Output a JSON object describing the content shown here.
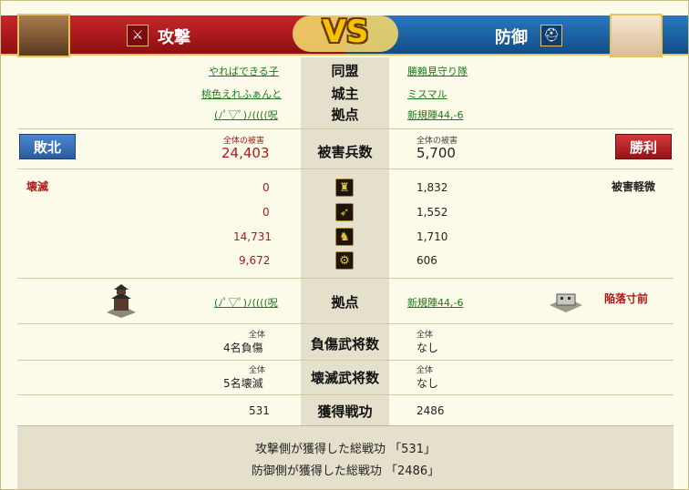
{
  "header": {
    "attack_label": "攻撃",
    "defense_label": "防御",
    "vs_label": "VS",
    "colors": {
      "attack": "#c8262a",
      "defense": "#2a78c0",
      "gold": "#e6c25a"
    }
  },
  "alliance": {
    "label": "同盟",
    "attacker": "やればできる子",
    "defender": "勝賴見守り隊"
  },
  "lord": {
    "label": "城主",
    "attacker": "桃色えれふぁんと",
    "defender": "ミスマル"
  },
  "base": {
    "label": "拠点",
    "attacker": "(ﾉﾟ▽ﾟ)ﾉ((((呪",
    "defender": "新規陣44,-6"
  },
  "damage": {
    "label": "被害兵数",
    "result_attacker": "敗北",
    "result_defender": "勝利",
    "attacker_caption": "全体の被害",
    "attacker_total": "24,403",
    "defender_caption": "全体の被害",
    "defender_total": "5,700"
  },
  "units": {
    "attacker_status": "壊滅",
    "defender_status": "被害軽微",
    "rows": [
      {
        "icon": "spear-icon",
        "attacker": "0",
        "defender": "1,832"
      },
      {
        "icon": "bow-icon",
        "attacker": "0",
        "defender": "1,552"
      },
      {
        "icon": "horse-icon",
        "attacker": "14,731",
        "defender": "1,710"
      },
      {
        "icon": "siege-icon",
        "attacker": "9,672",
        "defender": "606"
      }
    ]
  },
  "base_section": {
    "label": "拠点",
    "attacker": "(ﾉﾟ▽ﾟ)ﾉ((((呪",
    "defender": "新規陣44,-6",
    "defender_status": "陥落寸前"
  },
  "injured": {
    "label": "負傷武将数",
    "attacker_caption": "全体",
    "attacker": "4名負傷",
    "defender_caption": "全体",
    "defender": "なし"
  },
  "destroyed": {
    "label": "壊滅武将数",
    "attacker_caption": "全体",
    "attacker": "5名壊滅",
    "defender_caption": "全体",
    "defender": "なし"
  },
  "merit": {
    "label": "獲得戦功",
    "attacker": "531",
    "defender": "2486"
  },
  "footer": {
    "line1": "攻撃側が獲得した総戦功 「531」",
    "line2": "防御側が獲得した総戦功 「2486」"
  }
}
